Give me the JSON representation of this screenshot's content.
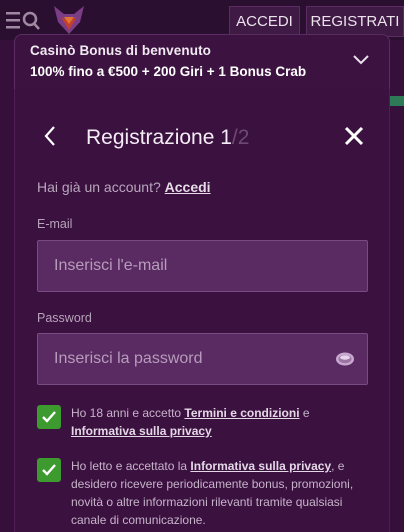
{
  "header": {
    "login_label": "ACCEDI",
    "register_label": "REGISTRATI",
    "menu_icon": "hamburger-search-icon",
    "logo_icon": "fox-logo-icon"
  },
  "banner": {
    "line1": "Casinò Bonus di benvenuto",
    "line2": "100% fino a €500 + 200 Giri + 1 Bonus Crab",
    "toggle_icon": "chevron-down-icon"
  },
  "modal": {
    "title": "Registrazione 1",
    "step_total": "/2",
    "back_icon": "chevron-left-icon",
    "close_icon": "close-icon",
    "have_account_text": "Hai già un account?",
    "have_account_link": "Accedi",
    "email": {
      "label": "E-mail",
      "placeholder": "Inserisci l'e-mail",
      "value": ""
    },
    "password": {
      "label": "Password",
      "placeholder": "Inserisci la password",
      "value": "",
      "toggle_icon": "eye-icon"
    },
    "consent_age": {
      "checked": true,
      "text_before": "Ho 18 anni e accetto ",
      "terms_link": "Termini e condizioni",
      "text_mid": " e ",
      "privacy_link": "Informativa sulla privacy"
    },
    "consent_marketing": {
      "checked": true,
      "text_before": "Ho letto e accettato la ",
      "privacy_link": "Informativa sulla privacy",
      "text_after": ", e desidero ricevere periodicamente bonus, promozioni, novità o altre informazioni rilevanti tramite qualsiasi canale di comunicazione."
    }
  },
  "colors": {
    "background": "#2a0e2f",
    "modal": "#3b1140",
    "input": "#5a2a62",
    "checkbox": "#3d9a2f"
  }
}
